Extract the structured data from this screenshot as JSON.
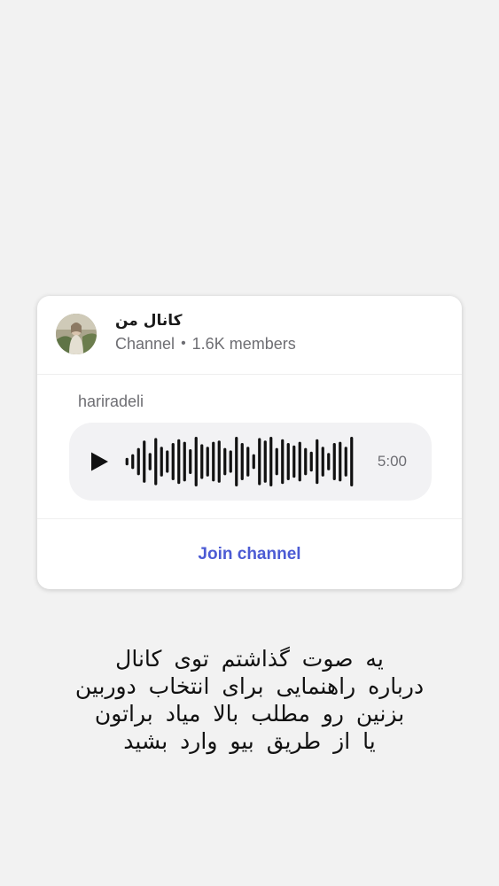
{
  "card": {
    "channel_title": "کانال من",
    "channel_type": "Channel",
    "separator": "•",
    "members": "1.6K members",
    "sender": "hariradeli",
    "voice": {
      "duration": "5:00",
      "waveform": [
        0.15,
        0.3,
        0.55,
        0.85,
        0.35,
        0.95,
        0.6,
        0.45,
        0.75,
        0.9,
        0.8,
        0.5,
        1.0,
        0.7,
        0.6,
        0.8,
        0.85,
        0.55,
        0.45,
        1.0,
        0.75,
        0.6,
        0.3,
        0.95,
        0.85,
        1.0,
        0.55,
        0.9,
        0.75,
        0.65,
        0.8,
        0.55,
        0.4,
        0.9,
        0.6,
        0.35,
        0.75,
        0.8,
        0.6,
        1.0
      ],
      "progress": 0
    },
    "join_label": "Join channel",
    "accent_color": "#4c5bd4"
  },
  "caption": {
    "lines": [
      "یه صوت گذاشتم توی کانال",
      "درباره راهنمایی برای انتخاب دوربین",
      "بزنین رو مطلب بالا میاد براتون",
      "یا از طریق بیو وارد بشید"
    ]
  }
}
